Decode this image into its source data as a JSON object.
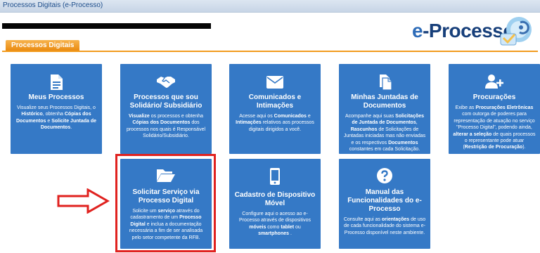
{
  "window": {
    "title": "Processos Digitais (e-Processo)"
  },
  "logo": {
    "text_e": "e",
    "text_rest": "-Processo",
    "tm": "®"
  },
  "tabs": [
    {
      "label": "Processos Digitais"
    }
  ],
  "colors": {
    "card": "#3579c6",
    "tab": "#f29b1e",
    "highlight": "#e0221f",
    "title_text": "#1d4d8b"
  },
  "cards": [
    {
      "icon": "document-icon",
      "title": "Meus Processos",
      "desc": [
        {
          "t": "Visualize seus Processos Digitais, o "
        },
        {
          "t": "Histórico",
          "b": true
        },
        {
          "t": ", obtenha "
        },
        {
          "t": "Cópias dos Documentos",
          "b": true
        },
        {
          "t": " e "
        },
        {
          "t": "Solicite Juntada de Documentos",
          "b": true
        },
        {
          "t": "."
        }
      ]
    },
    {
      "icon": "handshake-icon",
      "title": "Processos que sou Solidário/ Subsidiário",
      "desc": [
        {
          "t": "Visualize",
          "b": true
        },
        {
          "t": " os processos e obtenha "
        },
        {
          "t": "Cópias dos Documentos",
          "b": true
        },
        {
          "t": " dos processos nos quais é Responsável Solidário/Subsidiário."
        }
      ]
    },
    {
      "icon": "envelope-icon",
      "title": "Comunicados e Intimações",
      "desc": [
        {
          "t": "Acesse aqui os "
        },
        {
          "t": "Comunicados",
          "b": true
        },
        {
          "t": " e "
        },
        {
          "t": "Intimações",
          "b": true
        },
        {
          "t": " relativos aos processos digitais dirigidos a você."
        }
      ]
    },
    {
      "icon": "documents-icon",
      "title": "Minhas Juntadas de Documentos",
      "desc": [
        {
          "t": "Acompanhe aqui suas "
        },
        {
          "t": "Solicitações de Juntada de Documentos",
          "b": true
        },
        {
          "t": ", "
        },
        {
          "t": "Rascunhos",
          "b": true
        },
        {
          "t": " de Solicitações de Juntadas iniciadas mas não enviadas e os respectivos "
        },
        {
          "t": "Documentos",
          "b": true
        },
        {
          "t": " constantes em cada Solicitação."
        }
      ]
    },
    {
      "icon": "user-add-icon",
      "title": "Procurações",
      "desc": [
        {
          "t": "Exibe as "
        },
        {
          "t": "Procurações Eletrônicas",
          "b": true
        },
        {
          "t": " com outorga de poderes para representação de atuação no serviço \"Processo Digital\", podendo ainda, "
        },
        {
          "t": "alterar a seleção",
          "b": true
        },
        {
          "t": " de quais processos o representante pode atuar ("
        },
        {
          "t": "Restrição de Procuração",
          "b": true
        },
        {
          "t": ")."
        }
      ]
    },
    {
      "icon": "folder-open-icon",
      "title": "Solicitar Serviço via Processo Digital",
      "desc": [
        {
          "t": "Solicite um "
        },
        {
          "t": "serviço",
          "b": true
        },
        {
          "t": " através do cadastramento de um "
        },
        {
          "t": "Processo Digital",
          "b": true
        },
        {
          "t": " e inclua a documentação necessária a fim de ser analisada pelo setor competente da RFB."
        }
      ]
    },
    {
      "icon": "mobile-phone-icon",
      "title": "Cadastro de Dispositivo Móvel",
      "desc": [
        {
          "t": "Configure aqui o acesso ao e-Processo através de dispositivos "
        },
        {
          "t": "móveis",
          "b": true
        },
        {
          "t": " como "
        },
        {
          "t": "tablet",
          "b": true
        },
        {
          "t": " ou "
        },
        {
          "t": "smartphones",
          "b": true
        },
        {
          "t": " ."
        }
      ]
    },
    {
      "icon": "help-icon",
      "title": "Manual das Funcionalidades do e-Processo",
      "desc": [
        {
          "t": "Consulte aqui as "
        },
        {
          "t": "orientações",
          "b": true
        },
        {
          "t": " de uso de cada funcionalidade do sistema e-Processo disponível neste ambiente."
        }
      ]
    }
  ]
}
